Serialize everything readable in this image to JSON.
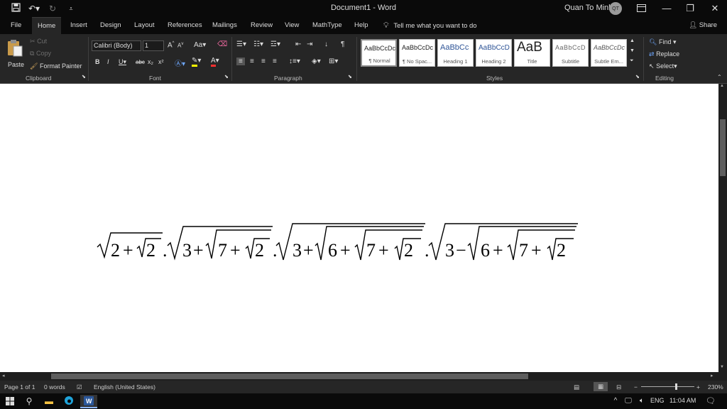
{
  "titlebar": {
    "doc_title": "Document1 - Word",
    "user_name": "Quan To Minh",
    "avatar_initials": "QT",
    "save_icon": "save-icon",
    "undo_icon": "undo-icon",
    "redo_icon": "redo-icon",
    "customize_icon": "customize-icon",
    "ribbon_display_icon": "ribbon-display-icon",
    "minimize_icon": "minimize-icon",
    "restore_icon": "restore-icon",
    "close_icon": "close-icon"
  },
  "tabs": [
    "File",
    "Home",
    "Insert",
    "Design",
    "Layout",
    "References",
    "Mailings",
    "Review",
    "View",
    "MathType",
    "Help"
  ],
  "active_tab": "Home",
  "tell_me": "Tell me what you want to do",
  "share": "Share",
  "ribbon": {
    "clipboard": {
      "label": "Clipboard",
      "paste": "Paste",
      "cut": "Cut",
      "copy": "Copy",
      "format_painter": "Format Painter"
    },
    "font": {
      "label": "Font",
      "font_name": "Calibri (Body)",
      "font_size": "1",
      "buttons": [
        "B",
        "I",
        "U",
        "abc",
        "x₂",
        "x²",
        "A",
        "Aa"
      ]
    },
    "paragraph": {
      "label": "Paragraph"
    },
    "styles": {
      "label": "Styles",
      "items": [
        {
          "sample": "AaBbCcDc",
          "name": "¶ Normal"
        },
        {
          "sample": "AaBbCcDc",
          "name": "¶ No Spac..."
        },
        {
          "sample": "AaBbCc",
          "name": "Heading 1"
        },
        {
          "sample": "AaBbCcD",
          "name": "Heading 2"
        },
        {
          "sample": "AaB",
          "name": "Title"
        },
        {
          "sample": "AaBbCcD",
          "name": "Subtitle"
        },
        {
          "sample": "AaBbCcDc",
          "name": "Subtle Em..."
        }
      ]
    },
    "editing": {
      "label": "Editing",
      "find": "Find",
      "replace": "Replace",
      "select": "Select"
    }
  },
  "document": {
    "equation": "√(2+√2) . √(3+√(7+√2)) . √(3+√(6+√(7+√2))) . √(3−√(6+√(7+√2)))"
  },
  "status": {
    "page": "Page 1 of 1",
    "words": "0 words",
    "language": "English (United States)",
    "zoom": "230%"
  },
  "taskbar": {
    "language": "ENG",
    "time": "11:04 AM"
  }
}
